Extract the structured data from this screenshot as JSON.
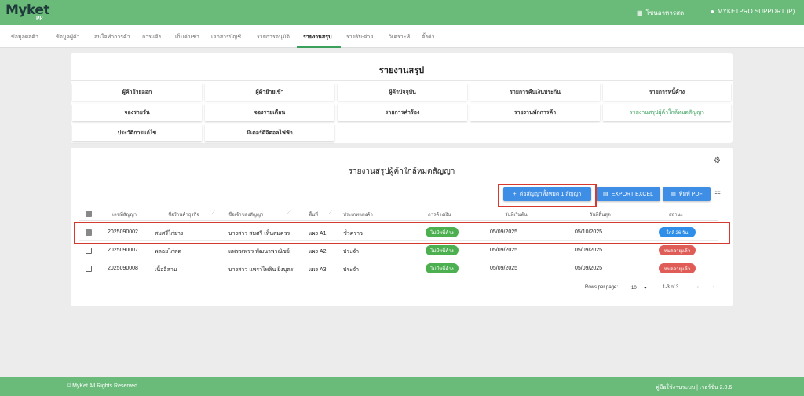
{
  "app": {
    "logo": "Myket",
    "logo_sub": "pp",
    "store": "โซนอาหารสด",
    "user": "MYKETPRO SUPPORT (P)"
  },
  "nav": [
    "ข้อมูลผลค้า",
    "ข้อมูลผู้ค้า",
    "สนใจทำการค้า",
    "การแจ้ง",
    "เก็บค่าเช่า",
    "เอกสารบัญชี",
    "รายการอนุมัติ",
    "รายงานสรุป",
    "รายรับ-จ่าย",
    "วิเคราะห์",
    "ตั้งค่า"
  ],
  "report": {
    "title": "รายงานสรุป",
    "buttons": [
      "ผู้ค้าย้ายออก",
      "ผู้ค้าย้ายเข้า",
      "ผู้ค้าปัจจุบัน",
      "รายการคืนเงินประกัน",
      "รายการหนี้ค้าง",
      "จองรายวัน",
      "จองรายเดือน",
      "รายการคำร้อง",
      "รายงานพักการค้า",
      "รายงานสรุปผู้ค้าใกล้หมดสัญญา",
      "ประวัติการแก้ไข",
      "มิเตอร์ดิจิตอลไฟฟ้า"
    ]
  },
  "contract": {
    "title": "รายงานสรุปผู้ค้าใกล้หมดสัญญา",
    "renew_button": "ต่อสัญญาทั้งหมด 1 สัญญา",
    "export_button": "EXPORT EXCEL",
    "print_button": "พิมพ์ PDF",
    "columns": [
      "เลขที่สัญญา",
      "ชื่อร้านค้าธุรกิจ",
      "ชื่อเจ้าของสัญญา",
      "พื้นที่",
      "ประเภทแผงค้า",
      "การค้างเงิน",
      "วันที่เริ่มต้น",
      "วันที่สิ้นสุด",
      "สถานะ"
    ],
    "rows": [
      {
        "id": "2025090002",
        "shop": "สมศรีไก่ย่าง",
        "owner": "นางสาว สมศรี เห็นสมควร",
        "area": "แผง A1",
        "type": "ชั่วคราว",
        "debt": "ไม่มีหนี้ค้าง",
        "start": "05/09/2025",
        "end": "05/10/2025",
        "status": "ใกล้ 26 วัน",
        "status_color": "blue",
        "checked": true
      },
      {
        "id": "2025090007",
        "shop": "พลอยไก่สด",
        "owner": "แพรวเพชร พัฒนาพาณิชย์",
        "area": "แผง A2",
        "type": "ประจำ",
        "debt": "ไม่มีหนี้ค้าง",
        "start": "05/09/2025",
        "end": "05/09/2025",
        "status": "หมดอายุแล้ว",
        "status_color": "red",
        "checked": false
      },
      {
        "id": "2025090008",
        "shop": "เนื้ออีสาน",
        "owner": "นางสาว แพรวไพลิน ยิ่งบุตร",
        "area": "แผง A3",
        "type": "ประจำ",
        "debt": "ไม่มีหนี้ค้าง",
        "start": "05/09/2025",
        "end": "05/09/2025",
        "status": "หมดอายุแล้ว",
        "status_color": "red",
        "checked": false
      }
    ],
    "pager": {
      "label": "Rows per page:",
      "per_page": "10",
      "range": "1-3 of 3"
    }
  },
  "footer": {
    "copyright": "© MyKet All Rights Reserved.",
    "version": "คู่มือใช้งานระบบ | เวอร์ชั่น 2.0.6"
  },
  "colors": {
    "brand": "#6abb7a",
    "accent_blue": "#3f8ee6",
    "highlight": "#d63a2e"
  }
}
